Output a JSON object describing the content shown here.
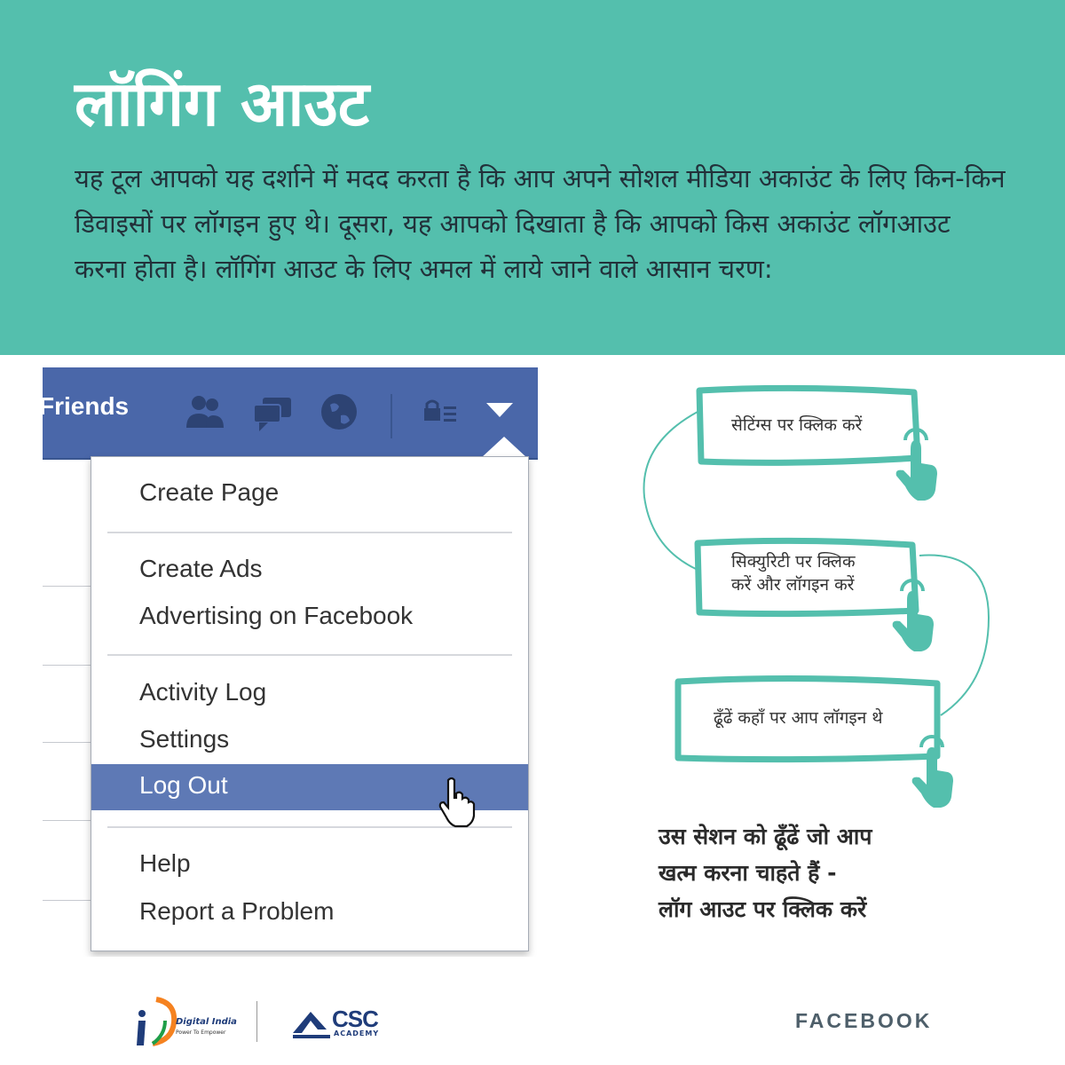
{
  "header": {
    "title": "लॉगिंग आउट",
    "description": "यह टूल आपको यह दर्शाने में मदद करता है कि आप अपने सोशल मीडिया अकाउंट के लिए किन-किन डिवाइसों पर लॉगइन हुए थे। दूसरा, यह आपको दिखाता है कि आपको किस अकाउंट  लॉगआउट करना होता है। लॉगिंग आउट के लिए अमल में लाये जाने वाले आसान चरण:"
  },
  "fb_screenshot": {
    "nav_label": "Friends",
    "icons": [
      "friends-icon",
      "messages-icon",
      "globe-icon",
      "privacy-shortcuts-icon",
      "dropdown-caret-icon"
    ],
    "menu": {
      "create_page": "Create Page",
      "create_ads": "Create Ads",
      "advertising": "Advertising on Facebook",
      "activity_log": "Activity Log",
      "settings": "Settings",
      "log_out": "Log Out",
      "help": "Help",
      "report": "Report a Problem"
    },
    "highlight_color": "#5e79b5",
    "bar_color": "#4a67a9"
  },
  "steps": [
    {
      "lines": [
        "सेटिंग्स पर क्लिक करें"
      ]
    },
    {
      "lines": [
        "सिक्युरिटी पर क्लिक",
        "करें और लॉगइन करें"
      ]
    },
    {
      "lines": [
        "ढूँढें कहाँ पर आप लॉगइन थे"
      ]
    }
  ],
  "final_step": {
    "lines": [
      "उस सेशन को ढूँढें जो आप",
      "खत्म करना चाहते हैं -",
      "लॉग आउट पर क्लिक करें"
    ]
  },
  "footer": {
    "digital_india": "Digital India",
    "digital_india_tagline": "Power To Empower",
    "csc": "CSC",
    "csc_sub": "ACADEMY",
    "brand": "FACEBOOK"
  },
  "colors": {
    "accent": "#54bfad",
    "text_dark": "#22313a"
  }
}
